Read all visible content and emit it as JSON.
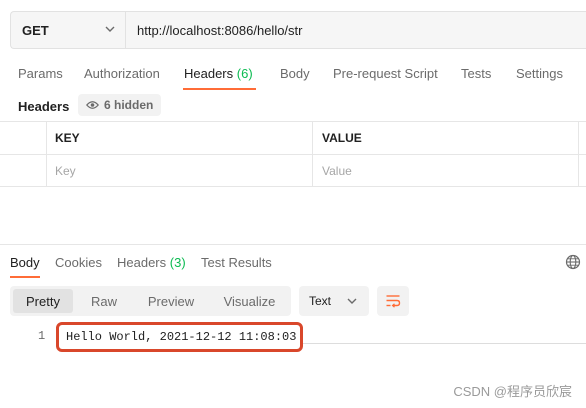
{
  "request": {
    "method": "GET",
    "url": "http://localhost:8086/hello/str"
  },
  "request_tabs": [
    {
      "label": "Params"
    },
    {
      "label": "Authorization"
    },
    {
      "label": "Headers",
      "count": "(6)",
      "active": true
    },
    {
      "label": "Body"
    },
    {
      "label": "Pre-request Script"
    },
    {
      "label": "Tests"
    },
    {
      "label": "Settings"
    }
  ],
  "headers_section": {
    "label": "Headers",
    "hidden_label": "6 hidden"
  },
  "headers_table": {
    "columns": [
      "KEY",
      "VALUE"
    ],
    "placeholders": {
      "key": "Key",
      "value": "Value"
    }
  },
  "response_tabs": [
    {
      "label": "Body",
      "active": true
    },
    {
      "label": "Cookies"
    },
    {
      "label": "Headers",
      "count": "(3)"
    },
    {
      "label": "Test Results"
    }
  ],
  "view_modes": [
    "Pretty",
    "Raw",
    "Preview",
    "Visualize"
  ],
  "active_view_mode": "Pretty",
  "format_select": "Text",
  "response_body": {
    "line_number": "1",
    "content": "Hello World, 2021-12-12 11:08:03"
  },
  "watermark": "CSDN @程序员欣宸",
  "colors": {
    "accent": "#ff6c37",
    "count_green": "#0cbb52",
    "highlight_border": "#d9472b"
  }
}
